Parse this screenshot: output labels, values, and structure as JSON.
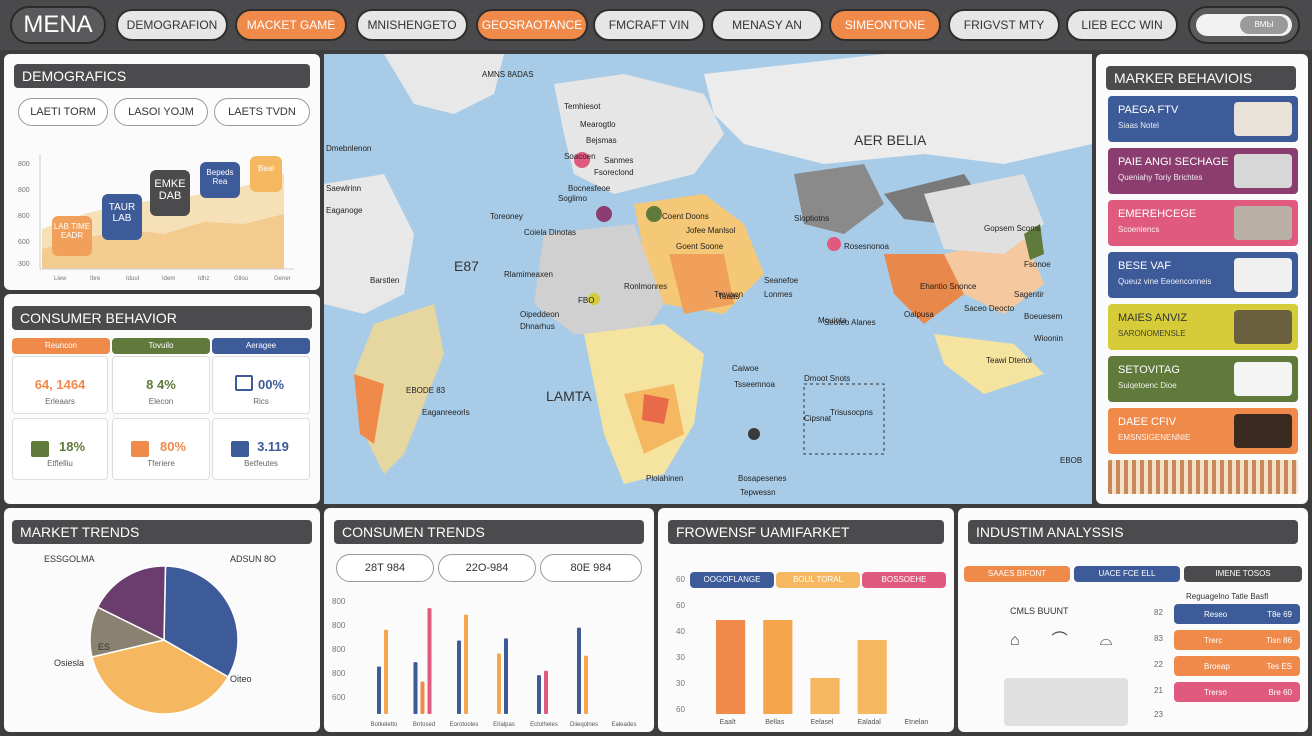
{
  "header": {
    "brand": "MENA",
    "nav": [
      {
        "label": "DEMOGRAFION",
        "style": "grey"
      },
      {
        "label": "MACKET GAME",
        "style": "orange"
      },
      {
        "label": "MNISHENGETO",
        "style": "grey"
      },
      {
        "label": "GEOSRAOTANCE",
        "style": "orange"
      },
      {
        "label": "FMCRAFT VIN",
        "style": "grey"
      },
      {
        "label": "MENASY AN",
        "style": "grey"
      },
      {
        "label": "SIMEONTONE",
        "style": "orange"
      },
      {
        "label": "FRIGVST MTY",
        "style": "grey"
      },
      {
        "label": "LIEB ECC WIN",
        "style": "grey"
      }
    ],
    "toggle_label": "ВМЫ"
  },
  "demographics": {
    "title": "DEMOGRAFICS",
    "chips": [
      "LAETI TORM",
      "LASOI YOJM",
      "LAETS TVDN"
    ],
    "y_ticks": [
      "800",
      "800",
      "800",
      "600",
      "300"
    ],
    "callouts": [
      {
        "label": "LAB TIME",
        "sub": "EADR",
        "color": "#f0a05a"
      },
      {
        "label": "TAUR",
        "sub": "LAB",
        "color": "#3d5a99"
      },
      {
        "label": "EMKE",
        "sub": "DAB",
        "color": "#4b4b4d"
      },
      {
        "label": "Bepeds",
        "sub": "Rea",
        "color": "#3d5a99"
      },
      {
        "label": "Beal",
        "sub": "",
        "color": "#f5b860"
      }
    ],
    "x_ticks": [
      "Liew",
      "Ibre",
      "Iduul",
      "Idem",
      "Idhz",
      "Gllou",
      "Gener"
    ]
  },
  "consumer_behavior": {
    "title": "CONSUMER BEHAVIOR",
    "tags": [
      {
        "label": "Reuncon",
        "color": "#f08a4b"
      },
      {
        "label": "Tovuilo",
        "color": "#5f7a3a"
      },
      {
        "label": "Aeragee",
        "color": "#3d5a99"
      }
    ],
    "stats": [
      {
        "value": "64, 1464",
        "label": "Erleaars",
        "color": "#f08a4b",
        "icon": "percent-icon"
      },
      {
        "value": "8  4%",
        "label": "Elecon",
        "color": "#5f7a3a",
        "icon": "percent-icon"
      },
      {
        "value": "00%",
        "label": "Rics",
        "color": "#3d5a99",
        "icon": "monitor-icon"
      },
      {
        "value": "18%",
        "label": "Etflelliu",
        "color": "#5f7a3a",
        "icon": "list-icon"
      },
      {
        "value": "80%",
        "label": "Tferiere",
        "color": "#f08a4b",
        "icon": "list-icon"
      },
      {
        "value": "3.119",
        "label": "Betfeutes",
        "color": "#3d5a99",
        "icon": "list-icon"
      }
    ]
  },
  "map": {
    "titles": [
      "AER BELIA",
      "LAMTA",
      "E87"
    ],
    "labels": [
      "AMNS 8ADAS",
      "Temhiesot",
      "Mearogtlo",
      "Bejsmas",
      "Sanmes",
      "Fsoreclond",
      "Coiela Dinotas",
      "Toreoney",
      "Soglimo",
      "Goent Soone",
      "Jofee Manlsol",
      "Eaganoge",
      "Coent Doons",
      "Lonmes",
      "FBO",
      "Oipeddeon",
      "Barstlen",
      "Dmoot Snots",
      "Trisusocpns",
      "Rlamimeaxen",
      "Dhnarhus",
      "Caiwoe",
      "EBODE 83",
      "Eaganreeorls",
      "Dmebnlenon",
      "Gopsem Scoms",
      "Sloptiotns",
      "Rosesnonoa",
      "Fsonoe",
      "Sagentir",
      "Boeuesem",
      "Wioonin",
      "Teawi Dtenoi",
      "Seoteo Alanes",
      "Oalpusa",
      "Saceo Deocto",
      "Ehantio Snonce",
      "Bosapesenes",
      "Tepwessn",
      "Ploiahinen",
      "Taaas",
      "Saewlrinn",
      "Tsseemnoa",
      "Soacoen",
      "Bocnesfeoe",
      "Mouinta",
      "Seanefoe",
      "Ronlmonres",
      "Trevaen",
      "Cipsnat",
      "EBOB"
    ]
  },
  "market_behavior": {
    "title": "MARKER BEHAVIOIS",
    "cards": [
      {
        "title": "PAEGA FTV",
        "sub": "Siaas Notel",
        "color": "#3d5a99",
        "img": "#e8e2d8"
      },
      {
        "title": "PAIE ANGI SECHAGE",
        "sub": "Queniahy  Toriy Brichtes",
        "color": "#8a3d6e",
        "img": "#d8d8d8"
      },
      {
        "title": "EMEREHCEGE",
        "sub": "Scoeniencs",
        "color": "#e05a80",
        "img": "#b8b0a4"
      },
      {
        "title": "BESE VAF",
        "sub": "Queuz vine Eeoenconneis",
        "color": "#3d5a99",
        "img": "#f0f0f0"
      },
      {
        "title": "MAIES ANVIZ",
        "sub": "SARONOMENSLE",
        "color": "#d6cc3a",
        "img": "#6a6040"
      },
      {
        "title": "SETOVITAG",
        "sub": "Suiqetoenc Dioe",
        "color": "#5f7a3a",
        "img": "#f4f4f4"
      },
      {
        "title": "DAEE CFIV",
        "sub": "EMSNSIGENENNIE",
        "color": "#f08a4b",
        "img": "#3a2a20"
      }
    ]
  },
  "market_trends": {
    "title": "MARKET TRENDS",
    "chart_data": {
      "type": "pie",
      "title": "",
      "slices": [
        {
          "label": "",
          "value": 33,
          "color": "#3d5a99"
        },
        {
          "label": "",
          "value": 38,
          "color": "#f5b860"
        },
        {
          "label": "",
          "value": 11,
          "color": "#8a8270"
        },
        {
          "label": "",
          "value": 18,
          "color": "#6a3d6e"
        }
      ],
      "annotations": [
        "ESSGOLMA",
        "ADSUN 8O",
        "Osiesla",
        "Oiteo",
        "ES"
      ]
    }
  },
  "consumer_trends": {
    "title": "CONSUMEN TRENDS",
    "chips": [
      "28T 984",
      "22O-984",
      "80E 984"
    ],
    "chart_data": {
      "type": "bar",
      "title": "",
      "ylabel": "",
      "y_ticks": [
        "800",
        "800",
        "800",
        "800",
        "600"
      ],
      "categories": [
        "Botkeletto",
        "Brrlosed",
        "Eorotooles",
        "Erlalpas",
        "Ectolheles",
        "Diieqolnes",
        "Ealeades"
      ],
      "series": [
        {
          "name": "",
          "color": "#3d5a99",
          "values": [
            44,
            48,
            68,
            0,
            36,
            80,
            0
          ]
        },
        {
          "name": "",
          "color": "#f5a64b",
          "values": [
            78,
            0,
            92,
            56,
            0,
            54,
            0
          ]
        },
        {
          "name": "",
          "color": "#f08a4b",
          "values": [
            0,
            30,
            0,
            0,
            0,
            0,
            0
          ]
        },
        {
          "name": "",
          "color": "#e05a80",
          "values": [
            0,
            98,
            0,
            0,
            40,
            0,
            0
          ]
        },
        {
          "name": "",
          "color": "#3d5a99",
          "values": [
            0,
            0,
            0,
            70,
            0,
            0,
            0
          ]
        }
      ]
    }
  },
  "fromwensf": {
    "title": "FROWENSF UAMIFARKET",
    "tags": [
      {
        "label": "OOGOFLANGE",
        "color": "#3d5a99"
      },
      {
        "label": "BOUL TORAL",
        "color": "#f5b860"
      },
      {
        "label": "BOSSOEHE",
        "color": "#e05a80"
      }
    ],
    "chart_data": {
      "type": "bar",
      "title": "",
      "y_ticks": [
        "60",
        "60",
        "40",
        "30",
        "30",
        "60"
      ],
      "categories": [
        "Eaalt",
        "Bellas",
        "Eelasel",
        "Ealadal",
        "Etnelan"
      ],
      "values": [
        94,
        94,
        36,
        74,
        0
      ],
      "colors": [
        "#f08a4b",
        "#f5a64b",
        "#f5b860",
        "#f5b860",
        "#f08a4b"
      ]
    }
  },
  "industry": {
    "title": "INDUSTIM ANALYSSIS",
    "tags": [
      {
        "label": "SAAES BIFONT",
        "color": "#f08a4b"
      },
      {
        "label": "UACE FCE ELL",
        "color": "#3d5a99"
      },
      {
        "label": "IMENE TOSOS",
        "color": "#4b4b4d"
      }
    ],
    "subheading": "CMLS BUUNT",
    "legend_title": "Reguagelno Tatle Basfl",
    "row_nums": [
      "82",
      "83",
      "22",
      "21",
      "23"
    ],
    "rows": [
      {
        "label": "Reseo",
        "value": "T8e 69",
        "color": "#3d5a99"
      },
      {
        "label": "Trerc",
        "value": "Tisn 86",
        "color": "#f08a4b"
      },
      {
        "label": "Broeap",
        "value": "Tes ES",
        "color": "#f08a4b"
      },
      {
        "label": "Trerso",
        "value": "Bre 60",
        "color": "#e05a80"
      }
    ]
  }
}
